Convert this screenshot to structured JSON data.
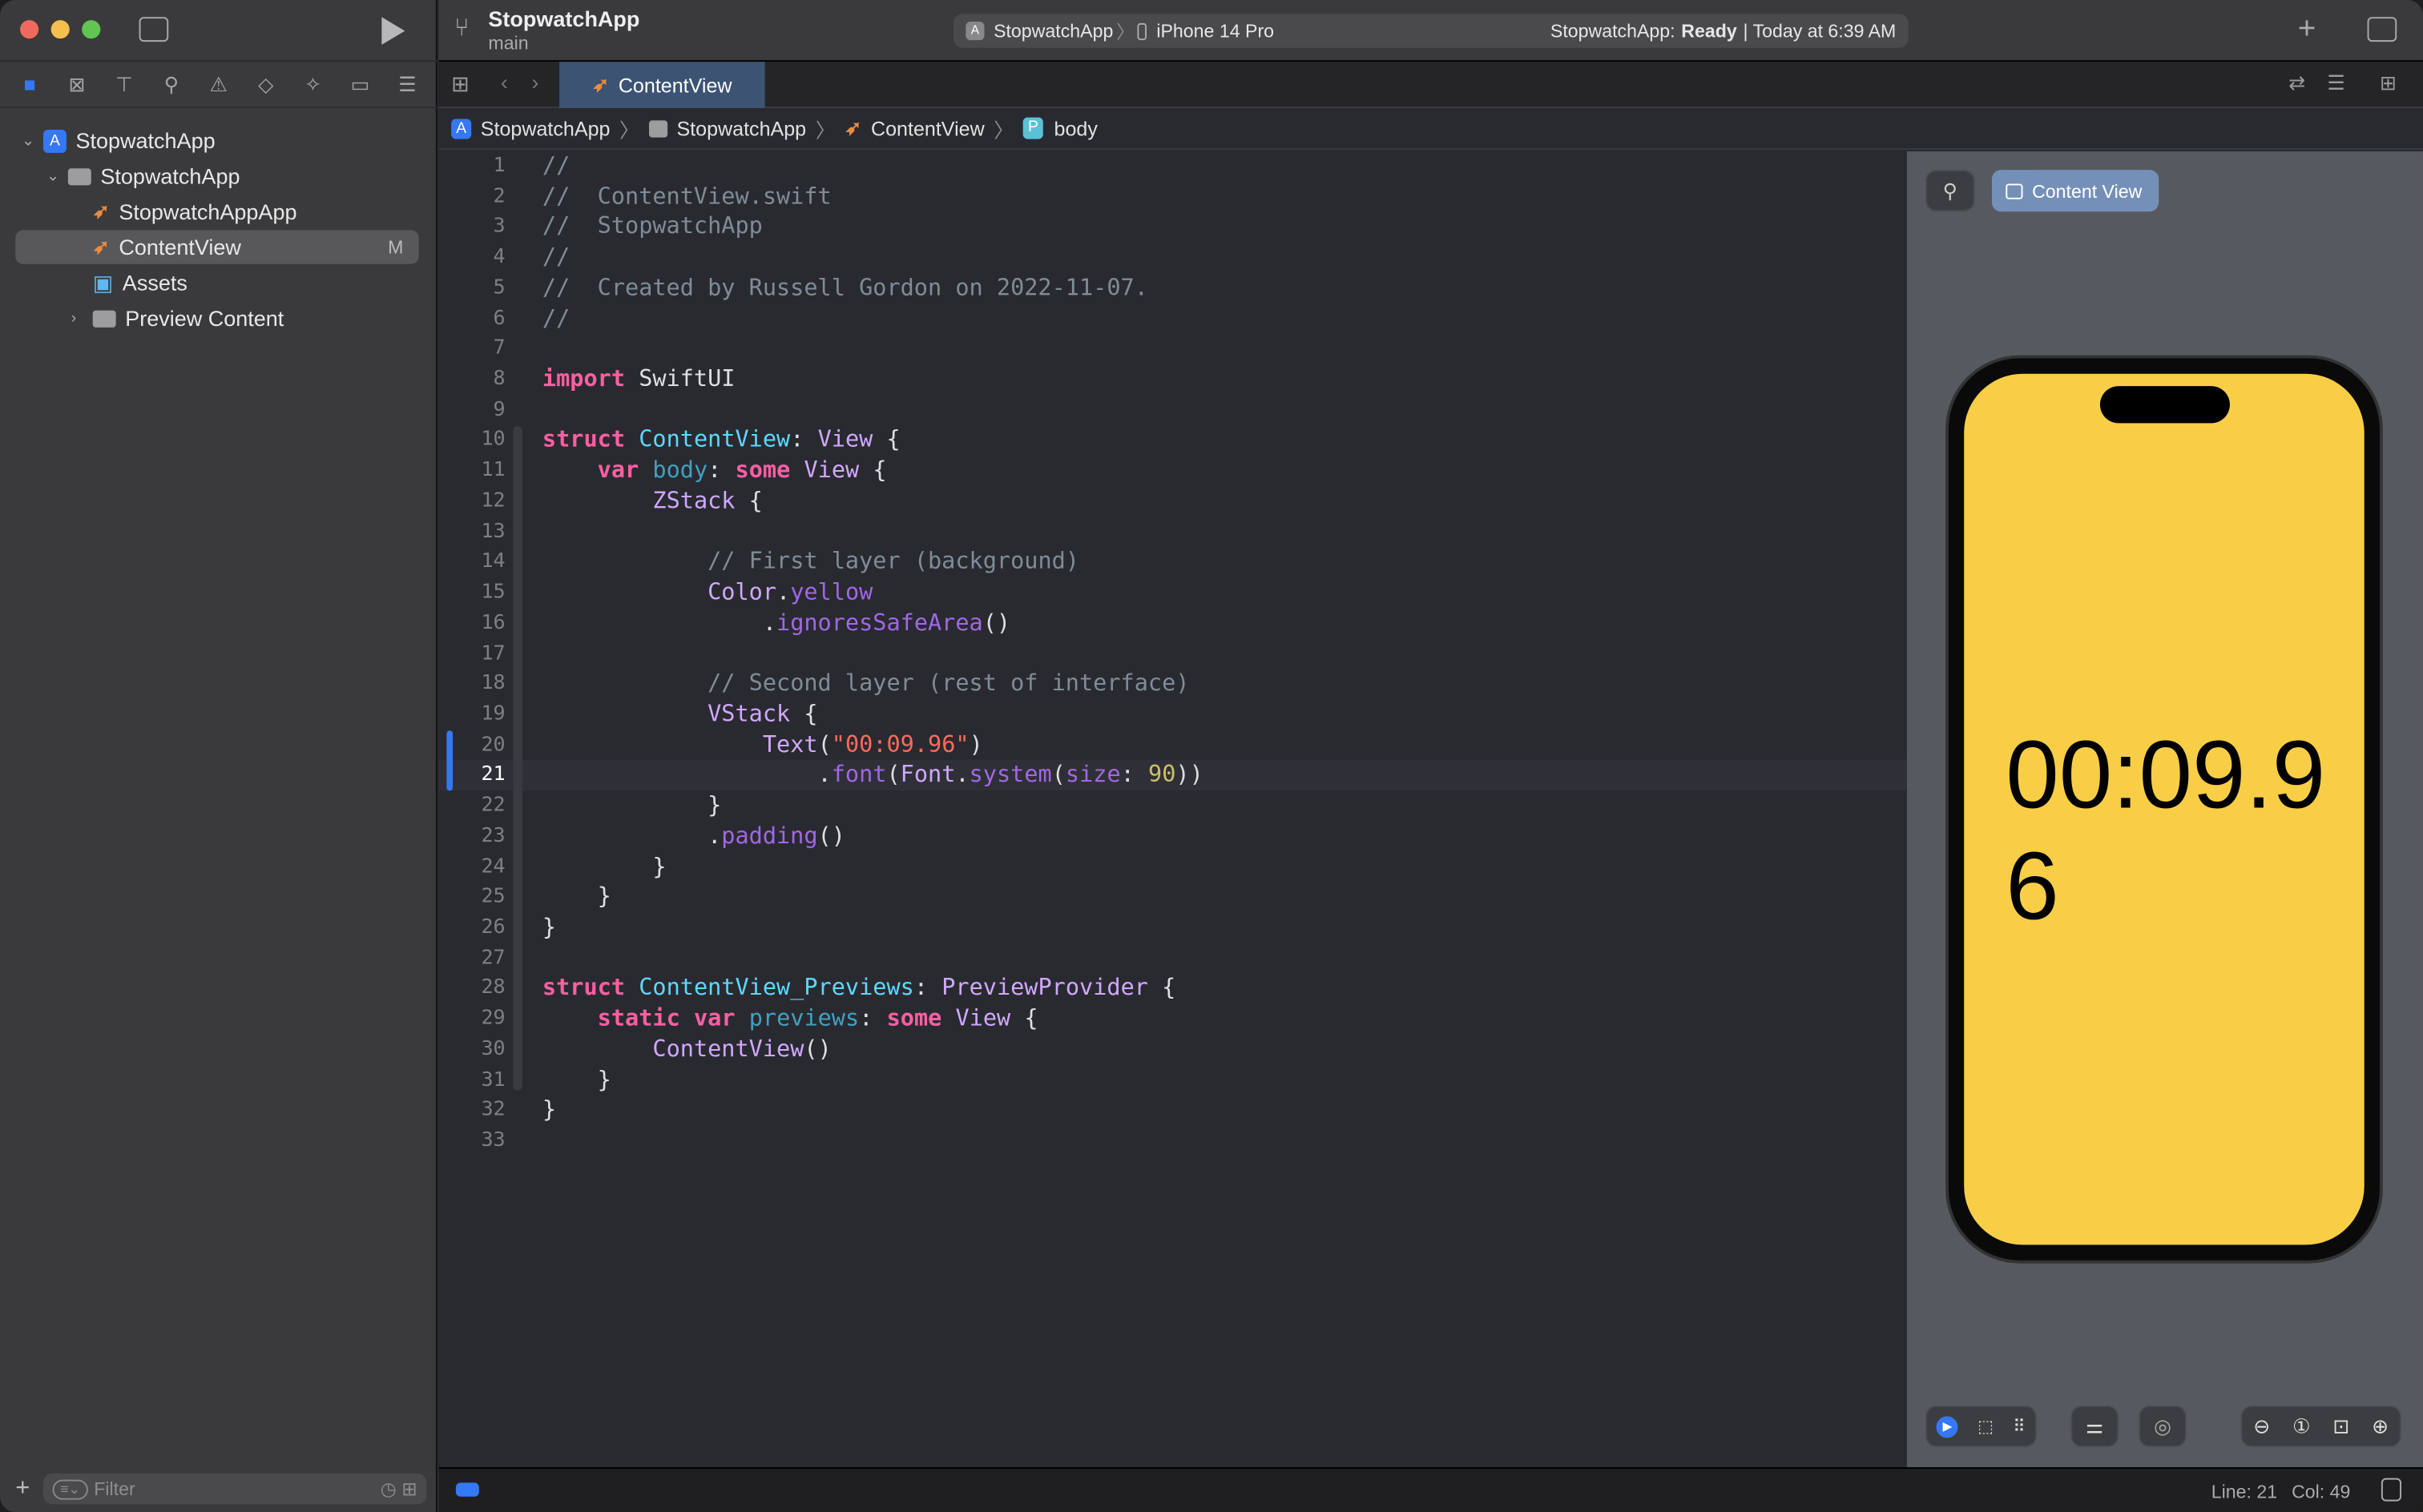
{
  "window": {
    "project": "StopwatchApp",
    "branch": "main"
  },
  "toolbar": {
    "scheme": "StopwatchApp",
    "device": "iPhone 14 Pro",
    "status_prefix": "StopwatchApp:",
    "status_state": "Ready",
    "status_time": "| Today at 6:39 AM"
  },
  "navigator": {
    "items": [
      {
        "label": "StopwatchApp",
        "icon": "app-icon",
        "level": 0,
        "expanded": true
      },
      {
        "label": "StopwatchApp",
        "icon": "folder-icon",
        "level": 1,
        "expanded": true
      },
      {
        "label": "StopwatchAppApp",
        "icon": "swift-file-icon",
        "level": 2
      },
      {
        "label": "ContentView",
        "icon": "swift-file-icon",
        "level": 2,
        "selected": true,
        "badge": "M"
      },
      {
        "label": "Assets",
        "icon": "assets-icon",
        "level": 2
      },
      {
        "label": "Preview Content",
        "icon": "folder-icon",
        "level": 2,
        "expanded": false
      }
    ],
    "filter_placeholder": "Filter"
  },
  "editor": {
    "tab": "ContentView",
    "breadcrumb": [
      "StopwatchApp",
      "StopwatchApp",
      "ContentView",
      "body"
    ],
    "lines": [
      [
        [
          "//",
          "cm"
        ]
      ],
      [
        [
          "//  ContentView.swift",
          "cm"
        ]
      ],
      [
        [
          "//  StopwatchApp",
          "cm"
        ]
      ],
      [
        [
          "//",
          "cm"
        ]
      ],
      [
        [
          "//  Created by Russell Gordon on 2022-11-07.",
          "cm"
        ]
      ],
      [
        [
          "//",
          "cm"
        ]
      ],
      [],
      [
        [
          "import",
          "kw"
        ],
        [
          " SwiftUI",
          ""
        ]
      ],
      [],
      [
        [
          "struct",
          "kw"
        ],
        [
          " ",
          ""
        ],
        [
          "ContentView",
          "td"
        ],
        [
          ": ",
          ""
        ],
        [
          "View",
          "ty"
        ],
        [
          " {",
          ""
        ]
      ],
      [
        [
          "    ",
          ""
        ],
        [
          "var",
          "kw"
        ],
        [
          " ",
          ""
        ],
        [
          "body",
          "de"
        ],
        [
          ": ",
          ""
        ],
        [
          "some",
          "kw"
        ],
        [
          " ",
          ""
        ],
        [
          "View",
          "ty"
        ],
        [
          " {",
          ""
        ]
      ],
      [
        [
          "        ",
          ""
        ],
        [
          "ZStack",
          "ty"
        ],
        [
          " {",
          ""
        ]
      ],
      [],
      [
        [
          "            ",
          ""
        ],
        [
          "// First layer (background)",
          "cm"
        ]
      ],
      [
        [
          "            ",
          ""
        ],
        [
          "Color",
          "ty"
        ],
        [
          ".",
          ""
        ],
        [
          "yellow",
          "me"
        ]
      ],
      [
        [
          "                .",
          ""
        ],
        [
          "ignoresSafeArea",
          "me"
        ],
        [
          "()",
          ""
        ]
      ],
      [],
      [
        [
          "            ",
          ""
        ],
        [
          "// Second layer (rest of interface)",
          "cm"
        ]
      ],
      [
        [
          "            ",
          ""
        ],
        [
          "VStack",
          "ty"
        ],
        [
          " {",
          ""
        ]
      ],
      [
        [
          "                ",
          ""
        ],
        [
          "Text",
          "ty"
        ],
        [
          "(",
          ""
        ],
        [
          "\"00:09.96\"",
          "st"
        ],
        [
          ")",
          ""
        ]
      ],
      [
        [
          "                    .",
          ""
        ],
        [
          "font",
          "me"
        ],
        [
          "(",
          ""
        ],
        [
          "Font",
          "ty"
        ],
        [
          ".",
          ""
        ],
        [
          "system",
          "me"
        ],
        [
          "(",
          ""
        ],
        [
          "size",
          "me"
        ],
        [
          ": ",
          ""
        ],
        [
          "90",
          "nu"
        ],
        [
          "))",
          ""
        ]
      ],
      [
        [
          "            }",
          ""
        ]
      ],
      [
        [
          "            .",
          ""
        ],
        [
          "padding",
          "me"
        ],
        [
          "()",
          ""
        ]
      ],
      [
        [
          "        }",
          ""
        ]
      ],
      [
        [
          "    }",
          ""
        ]
      ],
      [
        [
          "}",
          ""
        ]
      ],
      [],
      [
        [
          "struct",
          "kw"
        ],
        [
          " ",
          ""
        ],
        [
          "ContentView_Previews",
          "td"
        ],
        [
          ": ",
          ""
        ],
        [
          "PreviewProvider",
          "ty"
        ],
        [
          " {",
          ""
        ]
      ],
      [
        [
          "    ",
          ""
        ],
        [
          "static",
          "kw"
        ],
        [
          " ",
          ""
        ],
        [
          "var",
          "kw"
        ],
        [
          " ",
          ""
        ],
        [
          "previews",
          "de"
        ],
        [
          ": ",
          ""
        ],
        [
          "some",
          "kw"
        ],
        [
          " ",
          ""
        ],
        [
          "View",
          "ty"
        ],
        [
          " {",
          ""
        ]
      ],
      [
        [
          "        ",
          ""
        ],
        [
          "ContentView",
          "ty"
        ],
        [
          "()",
          ""
        ]
      ],
      [
        [
          "    }",
          ""
        ]
      ],
      [
        [
          "}",
          ""
        ]
      ],
      []
    ],
    "current_line": 21
  },
  "preview": {
    "label": "Content View",
    "timer_text": "00:09.96",
    "screen_color": "#f7ce46"
  },
  "status": {
    "line": "Line: 21",
    "col": "Col: 49"
  }
}
